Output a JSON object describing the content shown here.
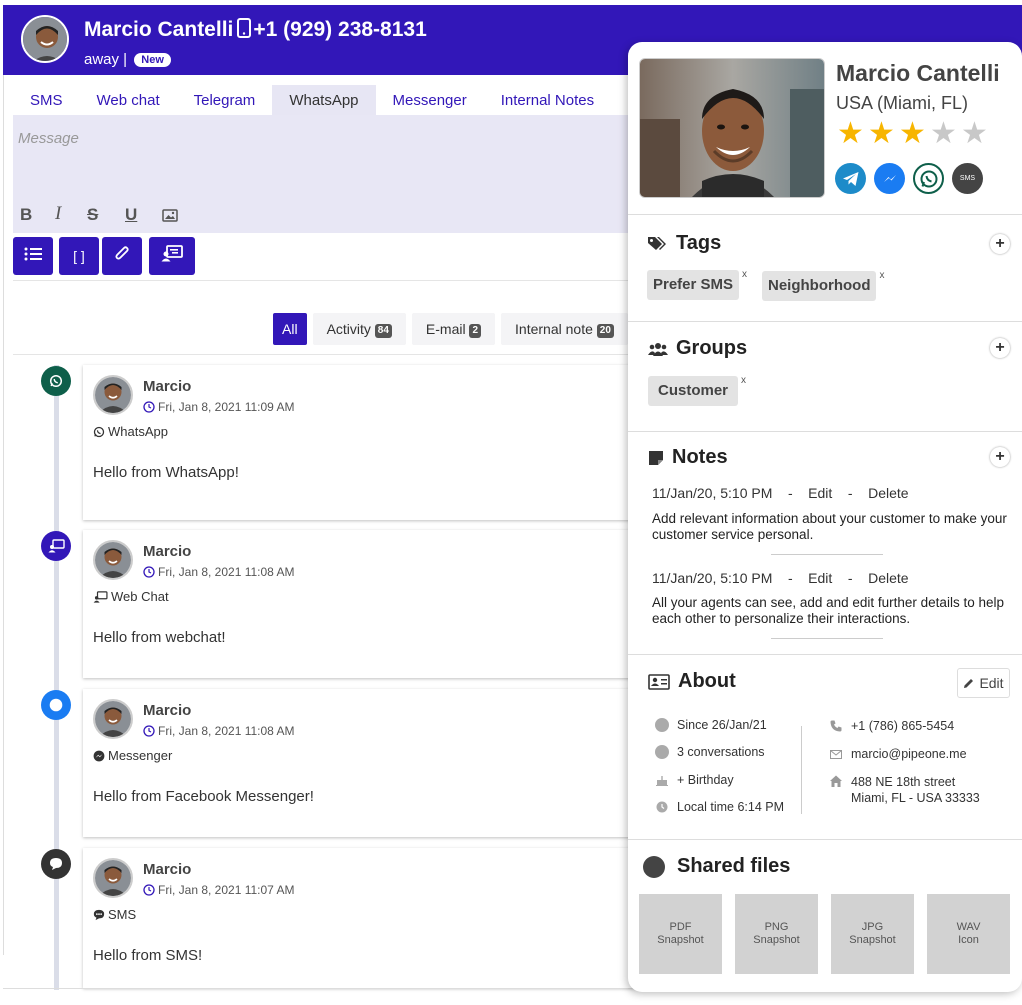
{
  "header": {
    "name": "Marcio Cantelli",
    "phone": "+1 (929) 238-8131",
    "status": "away |",
    "badge": "New",
    "colors": {
      "primary": "#3217b8"
    }
  },
  "tabs": [
    {
      "label": "SMS"
    },
    {
      "label": "Web chat"
    },
    {
      "label": "Telegram"
    },
    {
      "label": "WhatsApp",
      "active": true
    },
    {
      "label": "Messenger"
    },
    {
      "label": "Internal Notes"
    }
  ],
  "editor": {
    "placeholder": "Message",
    "format": {
      "bold": "B",
      "italic": "I",
      "strike": "S",
      "underline": "U"
    },
    "actions": [
      "list-icon",
      "brackets-icon",
      "paperclip-icon",
      "chat-screen-icon"
    ],
    "brackets": "[ ]"
  },
  "filters": [
    {
      "label": "All",
      "active": true
    },
    {
      "label": "Activity",
      "count": "84"
    },
    {
      "label": "E-mail",
      "count": "2"
    },
    {
      "label": "Internal note",
      "count": "20"
    }
  ],
  "messages": [
    {
      "author": "Marcio",
      "time": "Fri, Jan 8, 2021 11:09 AM",
      "channel": "WhatsApp",
      "text": "Hello from WhatsApp!",
      "icon": "whatsapp-icon",
      "color": "#0e5f4a"
    },
    {
      "author": "Marcio",
      "time": "Fri, Jan 8, 2021 11:08 AM",
      "channel": "Web Chat",
      "text": "Hello from webchat!",
      "icon": "webchat-icon",
      "color": "#3217b8"
    },
    {
      "author": "Marcio",
      "time": "Fri, Jan 8, 2021 11:08 AM",
      "channel": "Messenger",
      "text": "Hello from Facebook Messenger!",
      "icon": "messenger-icon",
      "color": "#1a7cf2"
    },
    {
      "author": "Marcio",
      "time": "Fri, Jan 8, 2021 11:07 AM",
      "channel": "SMS",
      "text": "Hello from SMS!",
      "icon": "sms-icon",
      "color": "#333333"
    }
  ],
  "profile": {
    "name": "Marcio Cantelli",
    "location": "USA (Miami, FL)",
    "rating": 3,
    "rating_max": 5,
    "star": "★",
    "social": [
      "telegram-icon",
      "messenger-icon",
      "whatsapp-icon",
      "sms-icon"
    ],
    "sms_label": "SMS"
  },
  "tags": {
    "title": "Tags",
    "add": "+",
    "items": [
      {
        "label": "Prefer SMS",
        "remove": "x"
      },
      {
        "label": "Neighborhood",
        "remove": "x"
      }
    ]
  },
  "groups": {
    "title": "Groups",
    "add": "+",
    "items": [
      {
        "label": "Customer",
        "remove": "x"
      }
    ]
  },
  "notes": {
    "title": "Notes",
    "add": "+",
    "items": [
      {
        "date": "11/Jan/20, 5:10 PM",
        "dash": "-",
        "edit": "Edit",
        "delete": "Delete",
        "text": "Add relevant information about your customer to make your customer service personal."
      },
      {
        "date": "11/Jan/20, 5:10 PM",
        "dash": "-",
        "edit": "Edit",
        "delete": "Delete",
        "text": "All your agents can see, add and edit further details to help each other to personalize their interactions."
      }
    ]
  },
  "about": {
    "title": "About",
    "edit": "Edit",
    "since": "Since 26/Jan/21",
    "conversations": "3 conversations",
    "birthday": "+ Birthday",
    "local_time": "Local time 6:14 PM",
    "phone": "+1 (786) 865-5454",
    "email": "marcio@pipeone.me",
    "address1": "488 NE 18th street",
    "address2": "Miami, FL - USA 33333"
  },
  "shared_files": {
    "title": "Shared files",
    "items": [
      {
        "type": "PDF",
        "kind": "Snapshot"
      },
      {
        "type": "PNG",
        "kind": "Snapshot"
      },
      {
        "type": "JPG",
        "kind": "Snapshot"
      },
      {
        "type": "WAV",
        "kind": "Icon"
      }
    ]
  }
}
